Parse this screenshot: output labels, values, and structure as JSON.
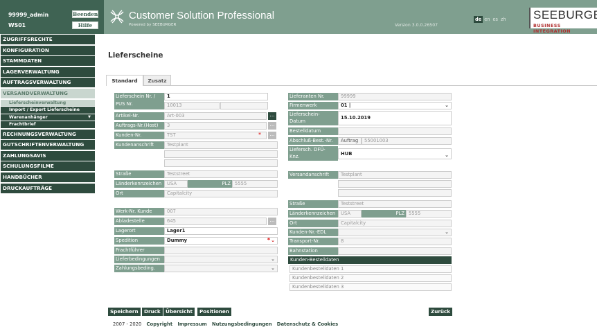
{
  "session": {
    "user": "99999_admin",
    "station": "WS01",
    "logout": "Beenden",
    "help": "Hilfe"
  },
  "header": {
    "title": "Customer Solution Professional",
    "powered": "Powered by SEEBURGER",
    "version": "Version 3.0.0.26507",
    "langs": [
      "de",
      "en",
      "es",
      "zh"
    ],
    "brand": "SEEBURGER",
    "brand_sub": "BUSINESS INTEGRATION"
  },
  "menu": {
    "main1": [
      "ZUGRIFFSRECHTE",
      "KONFIGURATION",
      "STAMMDATEN",
      "LAGERVERWALTUNG",
      "AUFTRAGSVERWALTUNG",
      "VERSANDVERWALTUNG"
    ],
    "sub": [
      "Lieferscheinverwaltung",
      "Import / Export Lieferscheine",
      "Warenanhänger",
      "Frachtbrief"
    ],
    "main2": [
      "RECHNUNGSVERWALTUNG",
      "GUTSCHRIFTENVERWALTUNG",
      "ZAHLUNGSAVIS",
      "SCHULUNGSFILME",
      "HANDBÜCHER",
      "DRUCKAUFTRÄGE"
    ]
  },
  "page_title": "Lieferscheine",
  "tabs": [
    "Standard",
    "Zusatz"
  ],
  "left": {
    "ls_nr_label": "Lieferschein Nr. /",
    "pus_label": "PUS Nr.",
    "ls_nr": "1",
    "pus_nr": "10013",
    "artikel_label": "Artikel-Nr.",
    "artikel": "Art-003",
    "auftrag_label": "Auftrags-Nr.(Host)",
    "auftrag": "3",
    "kunden_label": "Kunden-Nr.",
    "kunden": "TST",
    "anschrift_label": "Kundenanschrift",
    "anschrift": "Testplant",
    "strasse_label": "Straße",
    "strasse": "Teststreet",
    "land_label": "Länderkennzeichen",
    "land": "USA",
    "plz_label": "PLZ",
    "plz": "5555",
    "ort_label": "Ort",
    "ort": "Capitalcity",
    "werk_label": "Werk-Nr. Kunde",
    "werk": "007",
    "ablade_label": "Abladestelle",
    "ablade": "645",
    "lagerort_label": "Lagerort",
    "lagerort": "Lager1",
    "spedition_label": "Spedition",
    "spedition": "Dummy",
    "fracht_label": "Frachtführer",
    "lieferbed_label": "Lieferbedingungen",
    "zahlbed_label": "Zahlungsbeding."
  },
  "right": {
    "lief_label": "Lieferanten Nr.",
    "lief": "99999",
    "firmenwerk_label": "Firmenwerk",
    "firmenwerk": "01  |",
    "datum_label1": "Lieferschein-",
    "datum_label2": "Datum",
    "datum": "15.10.2019",
    "bestell_label": "Bestelldatum",
    "abschluss_label": "Abschluß-Best.-Nr.",
    "abschluss_type": "Auftrag",
    "abschluss": "55001003",
    "dfu_label1": "Liefersch. DFÜ-",
    "dfu_label2": "Knz.",
    "dfu": "HUB",
    "versand_label": "Versandanschrift",
    "versand": "Testplant",
    "strasse_label": "Straße",
    "strasse": "Teststreet",
    "land_label": "Länderkennzeichen",
    "land": "USA",
    "plz_label": "PLZ",
    "plz": "5555",
    "ort_label": "Ort",
    "ort": "Capitalcity",
    "edl_label": "Kunden-Nr.-EDL",
    "transport_label": "Transport-Nr.",
    "transport": "8",
    "bahn_label": "Bahnstation",
    "kb_header": "Kunden-Bestelldaten",
    "kb": [
      "Kundenbestelldaten 1",
      "Kundenbestelldaten 2",
      "Kundenbestelldaten 3"
    ]
  },
  "buttons": {
    "save": "Speichern",
    "print": "Druck",
    "overview": "Übersicht",
    "positions": "Positionen",
    "back": "Zurück",
    "dots": "..."
  },
  "footer": {
    "copy": "2007 - 2020",
    "links": [
      "Copyright",
      "Impressum",
      "Nutzungsbedingungen",
      "Datenschutz & Cookies"
    ]
  }
}
